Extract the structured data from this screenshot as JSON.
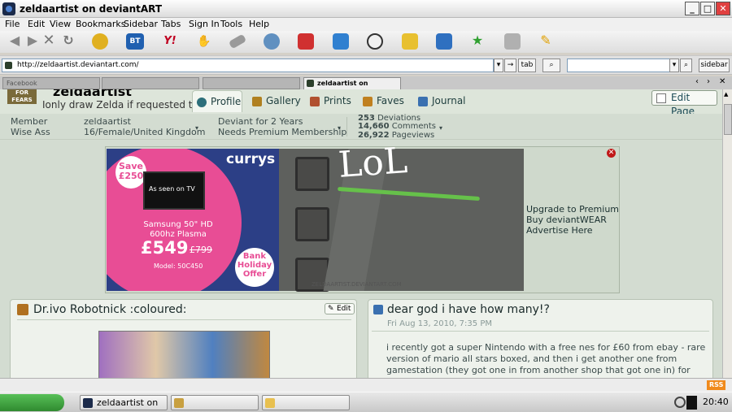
{
  "window": {
    "title": "zeldaartist on deviantART"
  },
  "menu": [
    "File",
    "Edit",
    "View",
    "Bookmarks",
    "Sidebar",
    "Tabs",
    "Sign In",
    "Tools",
    "Help"
  ],
  "toolbar": {
    "bt_label": "BT",
    "yahoo_label": "Y!"
  },
  "nav": {
    "url": "http://zeldaartist.deviantart.com/",
    "tab_button": "tab",
    "sidebar_button": "sidebar",
    "search_value": ""
  },
  "tabs": [
    {
      "label": "Facebook"
    },
    {
      "label": ""
    },
    {
      "label": ""
    },
    {
      "label": "zeldaartist on deviantA..."
    }
  ],
  "profile": {
    "username": "zeldaartist",
    "tagline": "Ionly draw Zelda if requested to",
    "avatar_text": "FOR FEARS",
    "tabs": [
      "Profile",
      "Gallery",
      "Prints",
      "Faves",
      "Journal"
    ],
    "edit_page": "Edit Page",
    "member_type": "Member",
    "member_title": "Wise Ass",
    "display_name": "zeldaartist",
    "demographics": "16/Female/United Kingdom",
    "deviant_for": "Deviant for 2 Years",
    "premium_note": "Needs Premium Membership",
    "stats": [
      {
        "value": "253",
        "label": "Deviations"
      },
      {
        "value": "14,660",
        "label": "Comments"
      },
      {
        "value": "26,922",
        "label": "Pageviews"
      }
    ]
  },
  "ad": {
    "save_badge": "Save £250",
    "seen_tv": "As seen on TV",
    "brand": "currys",
    "product": "Samsung 50\" HD 600hz Plasma",
    "price": "£549",
    "old_price": "£799",
    "model": "Model: 50C450",
    "bank_offer": "Bank Holiday Offer",
    "scrawl": "LoL",
    "watermark": "ZELDAARTIST.DEVIANTART.COM",
    "links": [
      "Upgrade to Premium",
      "Buy deviantWEAR",
      "Advertise Here"
    ]
  },
  "deviation": {
    "title": "Dr.ivo Robotnick :coloured:",
    "edit_label": "Edit"
  },
  "journal": {
    "title": "dear god i have how many!?",
    "date": "Fri Aug 13, 2010, 7:35 PM",
    "body": "i recently got a super Nintendo with a free nes for £60 from ebay - rare version of mario all stars boxed, and then i get another one from gamestation (they got one in from another shop that got one in) for £15 \"super nes control set\", and thenn i bid till the last seconds and get"
  },
  "status": {
    "rss": "RSS"
  },
  "taskbar": {
    "tasks": [
      {
        "label": "zeldaartist on de..."
      },
      {
        "label": ""
      },
      {
        "label": ""
      }
    ],
    "time": "20:40"
  },
  "colors": {
    "accent": "#1d3d3d",
    "ad_pink": "#e84d95",
    "ad_navy": "#2c3f86",
    "start_green": "#3aa63a"
  }
}
